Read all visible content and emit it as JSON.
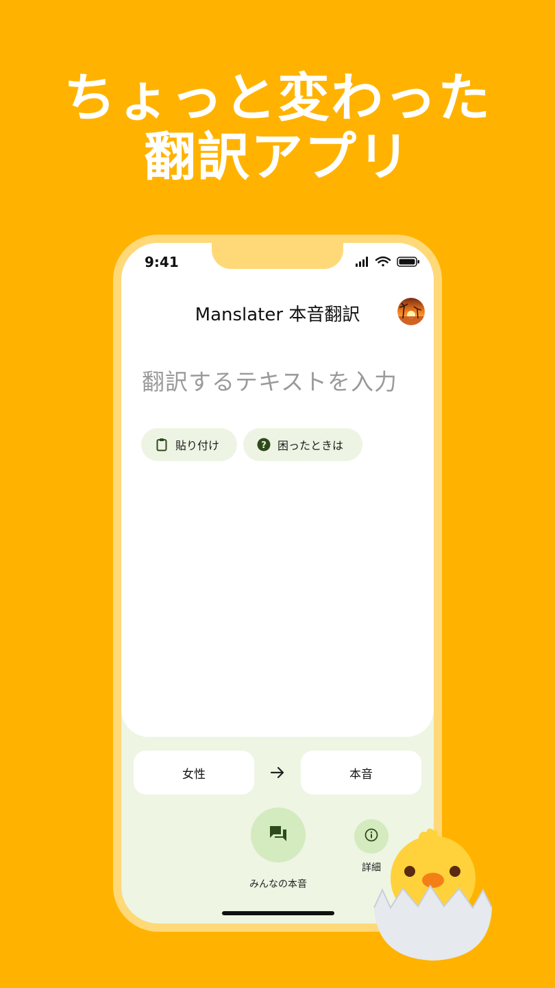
{
  "headline": {
    "line1": "ちょっと変わった",
    "line2": "翻訳アプリ"
  },
  "status_bar": {
    "time": "9:41",
    "icons": [
      "signal-icon",
      "wifi-icon",
      "battery-icon"
    ]
  },
  "app_bar": {
    "title": "Manslater 本音翻訳",
    "avatar": "sunset-avatar"
  },
  "input": {
    "placeholder": "翻訳するテキストを入力"
  },
  "chips": {
    "paste_label": "貼り付け",
    "help_label": "困ったときは"
  },
  "languages": {
    "from": "女性",
    "to": "本音"
  },
  "actions": {
    "community_label": "みんなの本音",
    "details_label": "詳細"
  },
  "colors": {
    "background": "#FFB300",
    "phone_frame": "#FFD978",
    "bottom_panel": "#EEF5E3",
    "chip_bg": "#EEF4E4",
    "button_green": "#D4EABF",
    "icon_dark_green": "#2E4A1A"
  }
}
